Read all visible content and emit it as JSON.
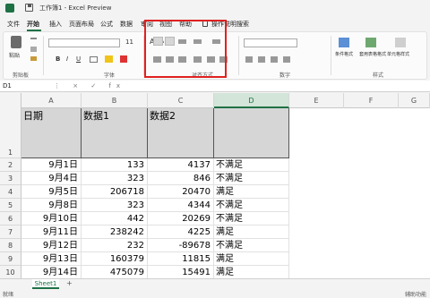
{
  "window": {
    "title": "工作簿1 - Excel Preview"
  },
  "menu": {
    "tabs": [
      {
        "label": "文件"
      },
      {
        "label": "开始"
      },
      {
        "label": "插入"
      },
      {
        "label": "页面布局"
      },
      {
        "label": "公式"
      },
      {
        "label": "数据"
      },
      {
        "label": "审阅"
      },
      {
        "label": "视图"
      },
      {
        "label": "帮助"
      },
      {
        "label": "操作说明搜索"
      }
    ]
  },
  "ribbon": {
    "paste_label": "粘贴",
    "clipboard_label": "剪贴板",
    "font_label": "字体",
    "font_size": "11",
    "bold": "B",
    "italic": "I",
    "underline": "U",
    "grow_font": "A",
    "shrink_font": "A",
    "align_label": "对齐方式",
    "number_label": "数字",
    "styles_label": "样式",
    "cond_format": "条件格式",
    "table_format": "套用表格格式",
    "cell_styles": "单元格样式"
  },
  "formula_bar": {
    "name_box": "D1",
    "icons": "⋮ × ✓ fx"
  },
  "columns": [
    "A",
    "B",
    "C",
    "D",
    "E",
    "F",
    "G"
  ],
  "header_row": {
    "a": "日期",
    "b": "数据1",
    "c": "数据2",
    "d": ""
  },
  "rows": [
    {
      "n": "2",
      "a": "9月1日",
      "b": "133",
      "c": "4137",
      "d": "不满足"
    },
    {
      "n": "3",
      "a": "9月4日",
      "b": "323",
      "c": "846",
      "d": "不满足"
    },
    {
      "n": "4",
      "a": "9月5日",
      "b": "206718",
      "c": "20470",
      "d": "满足"
    },
    {
      "n": "5",
      "a": "9月8日",
      "b": "323",
      "c": "4344",
      "d": "不满足"
    },
    {
      "n": "6",
      "a": "9月10日",
      "b": "442",
      "c": "20269",
      "d": "不满足"
    },
    {
      "n": "7",
      "a": "9月11日",
      "b": "238242",
      "c": "4225",
      "d": "满足"
    },
    {
      "n": "8",
      "a": "9月12日",
      "b": "232",
      "c": "-89678",
      "d": "不满足"
    },
    {
      "n": "9",
      "a": "9月13日",
      "b": "160379",
      "c": "11815",
      "d": "满足"
    },
    {
      "n": "10",
      "a": "9月14日",
      "b": "475079",
      "c": "15491",
      "d": "满足"
    }
  ],
  "row1_number": "1",
  "sheet_tab": "Sheet1",
  "add_sheet": "+",
  "status": {
    "ready": "就绪",
    "accessibility": "辅助功能"
  }
}
